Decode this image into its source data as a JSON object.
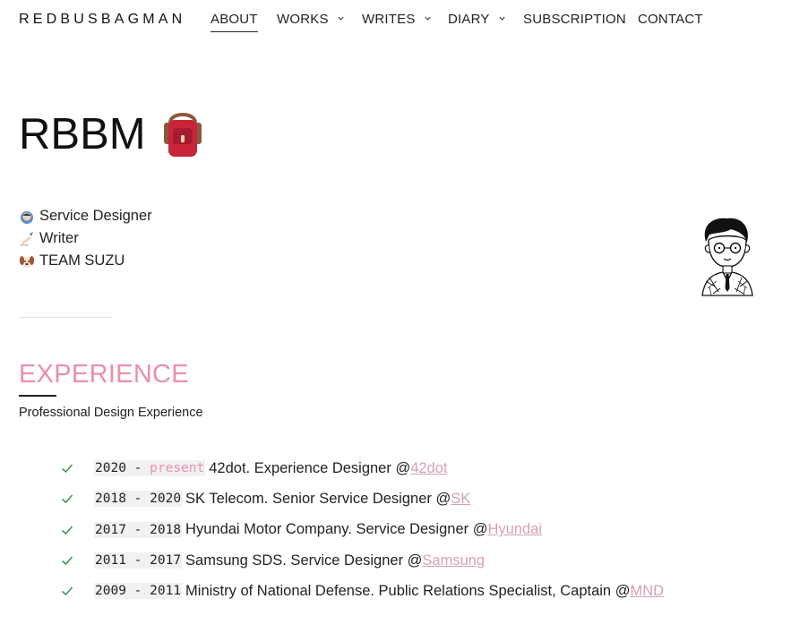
{
  "header": {
    "brand": "REDBUSBAGMAN",
    "nav": [
      {
        "label": "ABOUT",
        "active": true,
        "dropdown": false
      },
      {
        "label": "WORKS",
        "active": false,
        "dropdown": true
      },
      {
        "label": "WRITES",
        "active": false,
        "dropdown": true
      },
      {
        "label": "DIARY",
        "active": false,
        "dropdown": true
      },
      {
        "label": "SUBSCRIPTION",
        "active": false,
        "dropdown": false
      },
      {
        "label": "CONTACT",
        "active": false,
        "dropdown": false
      }
    ]
  },
  "hero": {
    "title": "RBBM",
    "title_icon": "backpack-icon"
  },
  "roles": [
    {
      "icon": "person-emoji-icon",
      "label": "Service Designer"
    },
    {
      "icon": "writing-hand-emoji-icon",
      "label": "Writer"
    },
    {
      "icon": "dog-emoji-icon",
      "label": "TEAM SUZU"
    }
  ],
  "experience": {
    "title": "EXPERIENCE",
    "subtitle": "Professional Design Experience",
    "items": [
      {
        "start": "2020",
        "sep": " - ",
        "end": "present",
        "text": "42dot. Experience Designer @",
        "link": "42dot"
      },
      {
        "start": "2018",
        "sep": " - ",
        "end": "2020",
        "text": "SK Telecom. Senior Service Designer @",
        "link": "SK"
      },
      {
        "start": "2017",
        "sep": " - ",
        "end": "2018",
        "text": "Hyundai Motor Company. Service Designer @",
        "link": "Hyundai"
      },
      {
        "start": "2011",
        "sep": " - ",
        "end": "2017",
        "text": "Samsung SDS. Service Designer @",
        "link": "Samsung"
      },
      {
        "start": "2009",
        "sep": " - ",
        "end": "2011",
        "text": "Ministry of National Defense. Public Relations Specialist, Captain @",
        "link": "MND"
      }
    ]
  },
  "colors": {
    "accent_pink": "#ec8fa9",
    "link_pink": "#d3a1b3",
    "check_green": "#3c9a5f",
    "backpack_red": "#c8243a"
  }
}
